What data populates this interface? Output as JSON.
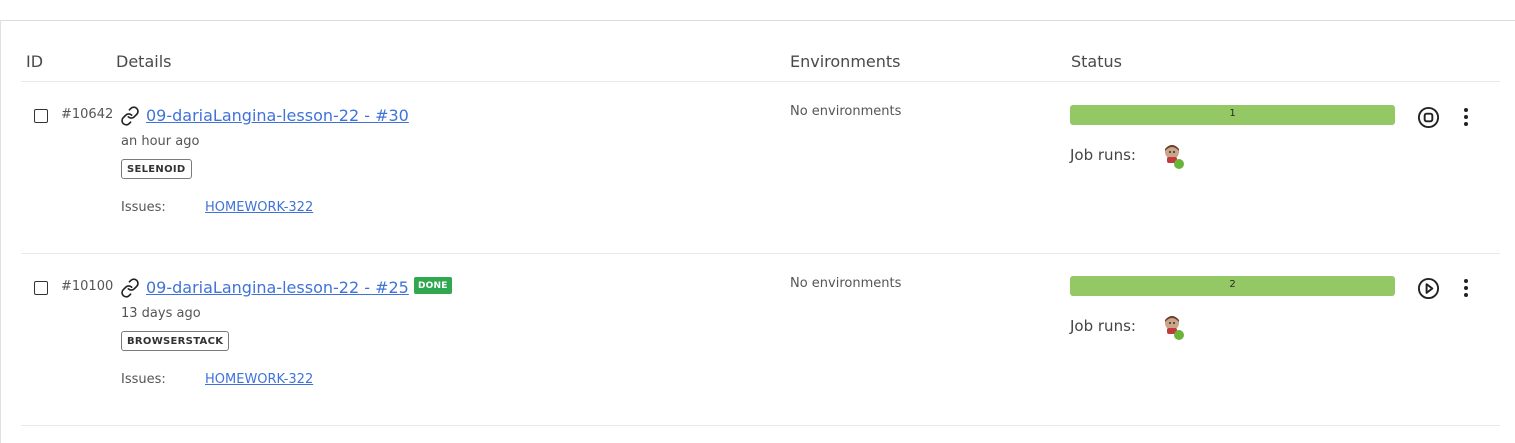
{
  "columns": {
    "id": "ID",
    "details": "Details",
    "environments": "Environments",
    "status": "Status"
  },
  "rows": [
    {
      "id": "#10642",
      "title": "09-dariaLangina-lesson-22 - #30",
      "time": "an hour ago",
      "tag": "SELENOID",
      "issues_label": "Issues:",
      "issue": "HOMEWORK-322",
      "environments": "No environments",
      "status_count": "1",
      "job_runs_label": "Job runs:",
      "action": "stop-icon"
    },
    {
      "id": "#10100",
      "title": "09-dariaLangina-lesson-22 - #25",
      "badge": "DONE",
      "time": "13 days ago",
      "tag": "BROWSERSTACK",
      "issues_label": "Issues:",
      "issue": "HOMEWORK-322",
      "environments": "No environments",
      "status_count": "2",
      "job_runs_label": "Job runs:",
      "action": "play-icon"
    }
  ],
  "colors": {
    "link": "#3f73d9",
    "status_bar": "#93c864",
    "done_badge": "#2fa84f",
    "job_ok_dot": "#6ab43a"
  }
}
